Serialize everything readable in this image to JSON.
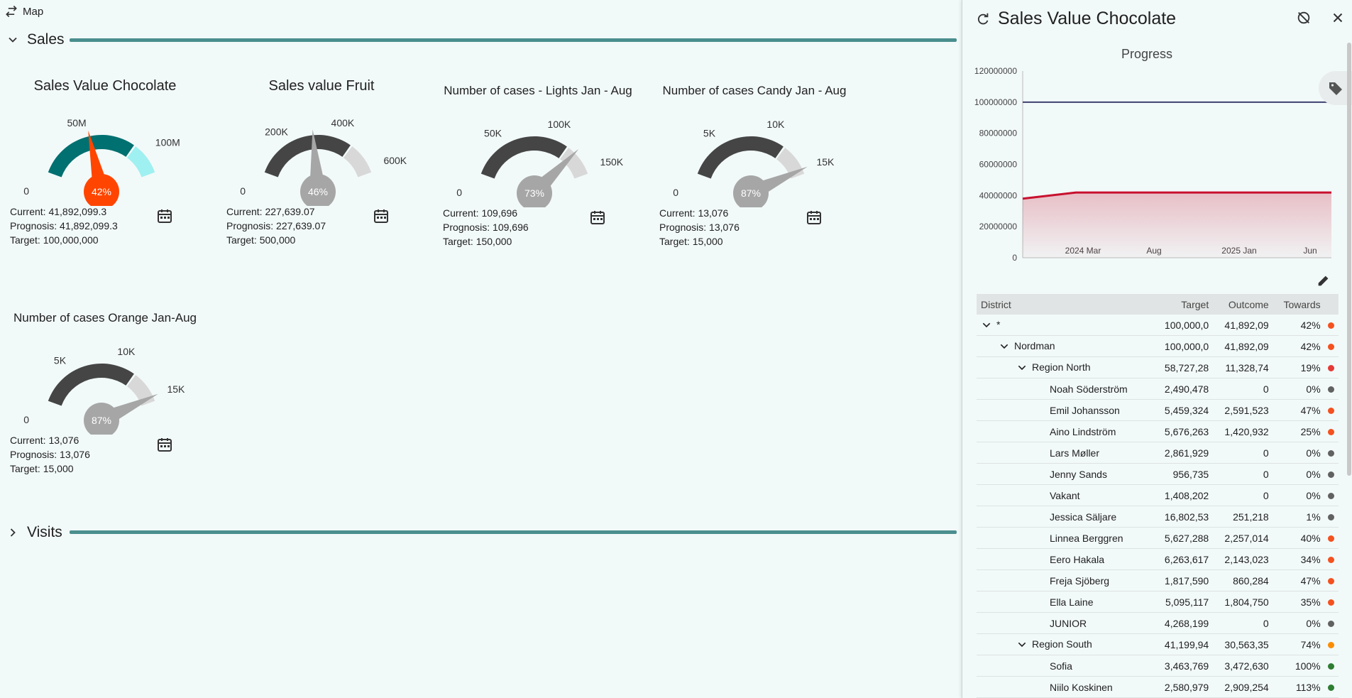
{
  "topbar": {
    "map_label": "Map"
  },
  "sections": {
    "sales": "Sales",
    "visits": "Visits"
  },
  "gauges": [
    {
      "title": "Sales Value Chocolate",
      "ticks": [
        "0",
        "50M",
        "100M"
      ],
      "percent": "42%",
      "current": "Current: 41,892,099.3",
      "prognosis": "Prognosis: 41,892,099.3",
      "target": "Target: 100,000,000",
      "value_fraction": 0.42,
      "active": true
    },
    {
      "title": "Sales value Fruit",
      "ticks": [
        "0",
        "200K",
        "400K",
        "600K"
      ],
      "percent": "46%",
      "current": "Current: 227,639.07",
      "prognosis": "Prognosis: 227,639.07",
      "target": "Target: 500,000",
      "value_fraction": 0.46,
      "active": false
    },
    {
      "title": "Number of cases - Lights Jan - Aug",
      "ticks": [
        "0",
        "50K",
        "100K",
        "150K"
      ],
      "percent": "73%",
      "current": "Current: 109,696",
      "prognosis": "Prognosis: 109,696",
      "target": "Target: 150,000",
      "value_fraction": 0.73,
      "active": false
    },
    {
      "title": "Number of cases Candy Jan - Aug",
      "ticks": [
        "0",
        "5K",
        "10K",
        "15K"
      ],
      "percent": "87%",
      "current": "Current: 13,076",
      "prognosis": "Prognosis: 13,076",
      "target": "Target: 15,000",
      "value_fraction": 0.87,
      "active": false
    },
    {
      "title": "Number of cases Orange Jan-Aug",
      "ticks": [
        "0",
        "5K",
        "10K",
        "15K"
      ],
      "percent": "87%",
      "current": "Current: 13,076",
      "prognosis": "Prognosis: 13,076",
      "target": "Target: 15,000",
      "value_fraction": 0.87,
      "active": false
    }
  ],
  "panel": {
    "title": "Sales Value Chocolate",
    "chart_title": "Progress",
    "columns": {
      "district": "District",
      "target": "Target",
      "outcome": "Outcome",
      "towards": "Towards"
    },
    "rows": [
      {
        "level": 0,
        "caret": true,
        "name": "*",
        "target": "100,000,0",
        "outcome": "41,892,09",
        "towards": "42%",
        "color": "#f4511e"
      },
      {
        "level": 1,
        "caret": true,
        "name": "Nordman",
        "target": "100,000,0",
        "outcome": "41,892,09",
        "towards": "42%",
        "color": "#f4511e"
      },
      {
        "level": 2,
        "caret": true,
        "name": "Region North",
        "target": "58,727,28",
        "outcome": "11,328,74",
        "towards": "19%",
        "color": "#e53935"
      },
      {
        "level": 3,
        "caret": false,
        "name": "Noah Söderström",
        "target": "2,490,478",
        "outcome": "0",
        "towards": "0%",
        "color": "#616161"
      },
      {
        "level": 3,
        "caret": false,
        "name": "Emil Johansson",
        "target": "5,459,324",
        "outcome": "2,591,523",
        "towards": "47%",
        "color": "#f4511e"
      },
      {
        "level": 3,
        "caret": false,
        "name": "Aino Lindström",
        "target": "5,676,263",
        "outcome": "1,420,932",
        "towards": "25%",
        "color": "#f4511e"
      },
      {
        "level": 3,
        "caret": false,
        "name": "Lars Møller",
        "target": "2,861,929",
        "outcome": "0",
        "towards": "0%",
        "color": "#616161"
      },
      {
        "level": 3,
        "caret": false,
        "name": "Jenny Sands",
        "target": "956,735",
        "outcome": "0",
        "towards": "0%",
        "color": "#616161"
      },
      {
        "level": 3,
        "caret": false,
        "name": "Vakant",
        "target": "1,408,202",
        "outcome": "0",
        "towards": "0%",
        "color": "#616161"
      },
      {
        "level": 3,
        "caret": false,
        "name": "Jessica Säljare",
        "target": "16,802,53",
        "outcome": "251,218",
        "towards": "1%",
        "color": "#616161"
      },
      {
        "level": 3,
        "caret": false,
        "name": "Linnea Berggren",
        "target": "5,627,288",
        "outcome": "2,257,014",
        "towards": "40%",
        "color": "#f4511e"
      },
      {
        "level": 3,
        "caret": false,
        "name": "Eero Hakala",
        "target": "6,263,617",
        "outcome": "2,143,023",
        "towards": "34%",
        "color": "#f4511e"
      },
      {
        "level": 3,
        "caret": false,
        "name": "Freja Sjöberg",
        "target": "1,817,590",
        "outcome": "860,284",
        "towards": "47%",
        "color": "#f4511e"
      },
      {
        "level": 3,
        "caret": false,
        "name": "Ella Laine",
        "target": "5,095,117",
        "outcome": "1,804,750",
        "towards": "35%",
        "color": "#f4511e"
      },
      {
        "level": 3,
        "caret": false,
        "name": "JUNIOR",
        "target": "4,268,199",
        "outcome": "0",
        "towards": "0%",
        "color": "#616161"
      },
      {
        "level": 2,
        "caret": true,
        "name": "Region South",
        "target": "41,199,94",
        "outcome": "30,563,35",
        "towards": "74%",
        "color": "#fb8c00"
      },
      {
        "level": 3,
        "caret": false,
        "name": "Sofia",
        "target": "3,463,769",
        "outcome": "3,472,630",
        "towards": "100%",
        "color": "#2e7d32"
      },
      {
        "level": 3,
        "caret": false,
        "name": "Niilo Koskinen",
        "target": "2,580,979",
        "outcome": "2,909,254",
        "towards": "113%",
        "color": "#2e7d32"
      }
    ]
  },
  "chart_data": {
    "type": "area",
    "title": "Progress",
    "x_tick_labels": [
      "2024 Mar",
      "Aug",
      "2025 Jan",
      "Jun"
    ],
    "y_tick_labels": [
      "0",
      "20000000",
      "40000000",
      "60000000",
      "80000000",
      "100000000",
      "120000000"
    ],
    "ylim": [
      0,
      120000000
    ],
    "series": [
      {
        "values": [
          100000000,
          100000000,
          100000000,
          100000000,
          100000000,
          100000000
        ],
        "color": "#3d4170"
      },
      {
        "values": [
          38000000,
          41892099,
          41892099,
          41892099,
          41892099,
          41892099
        ],
        "color": "#c8102e"
      }
    ]
  }
}
